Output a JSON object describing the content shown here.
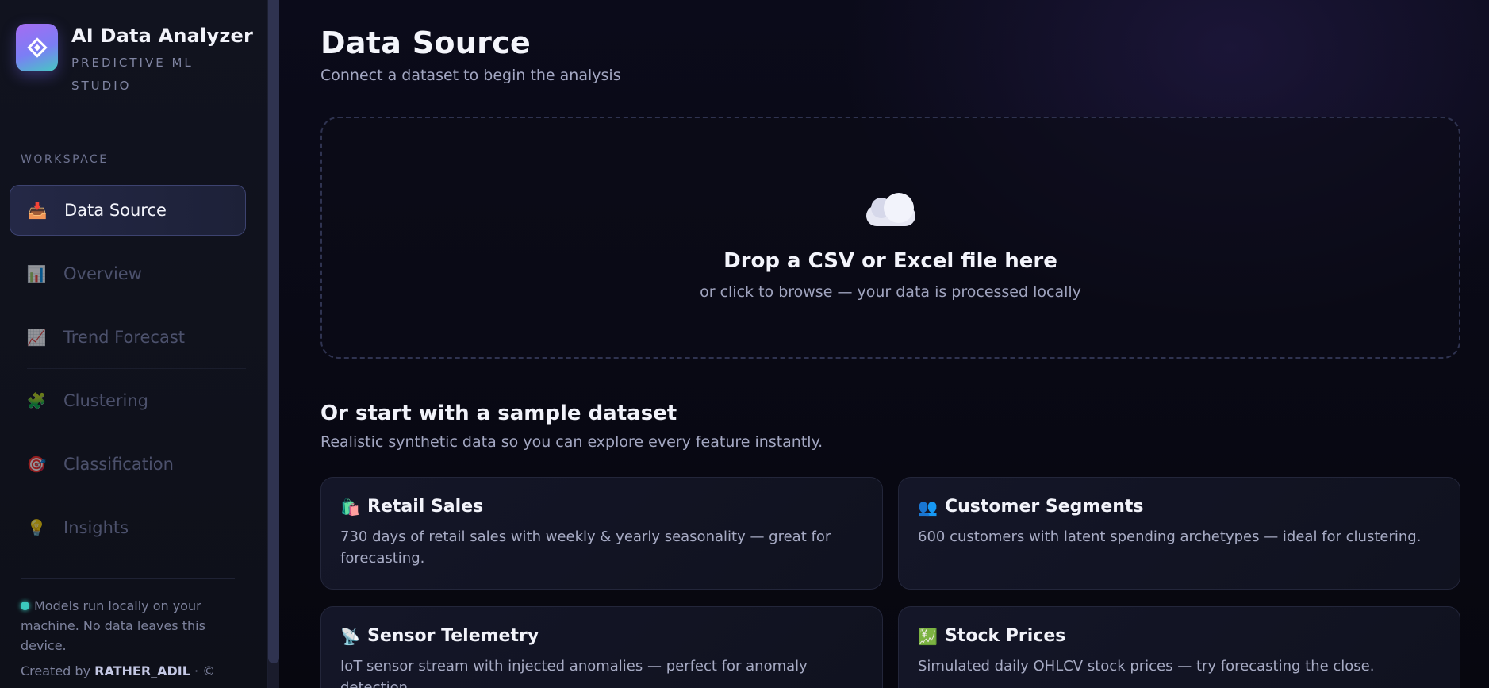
{
  "brand": {
    "title": "AI Data Analyzer",
    "subtitle": "PREDICTIVE ML STUDIO"
  },
  "sidebar": {
    "section_label": "WORKSPACE",
    "items": [
      {
        "label": "Data Source",
        "icon": "inbox-tray-icon",
        "glyph": "📥",
        "active": true
      },
      {
        "label": "Overview",
        "icon": "bar-chart-icon",
        "glyph": "📊",
        "active": false
      },
      {
        "label": "Trend Forecast",
        "icon": "chart-increasing-icon",
        "glyph": "📈",
        "active": false
      },
      {
        "label": "Clustering",
        "icon": "puzzle-piece-icon",
        "glyph": "🧩",
        "active": false
      },
      {
        "label": "Classification",
        "icon": "target-icon",
        "glyph": "🎯",
        "active": false
      },
      {
        "label": "Insights",
        "icon": "light-bulb-icon",
        "glyph": "💡",
        "active": false
      }
    ],
    "local_note": "Models run locally on your machine. No data leaves this device.",
    "credit_prefix": "Created by",
    "credit_name": "RATHER_ADIL",
    "credit_suffix": "· ©"
  },
  "main": {
    "title": "Data Source",
    "subtitle": "Connect a dataset to begin the analysis",
    "dropzone": {
      "icon": "cloud-icon",
      "title": "Drop a CSV or Excel file here",
      "subtitle": "or click to browse — your data is processed locally"
    },
    "samples": {
      "title": "Or start with a sample dataset",
      "subtitle": "Realistic synthetic data so you can explore every feature instantly.",
      "cards": [
        {
          "title": "Retail Sales",
          "icon": "shopping-bags-icon",
          "glyph": "🛍️",
          "description": "730 days of retail sales with weekly & yearly seasonality — great for forecasting."
        },
        {
          "title": "Customer Segments",
          "icon": "people-icon",
          "glyph": "👥",
          "description": "600 customers with latent spending archetypes — ideal for clustering."
        },
        {
          "title": "Sensor Telemetry",
          "icon": "satellite-antenna-icon",
          "glyph": "📡",
          "description": "IoT sensor stream with injected anomalies — perfect for anomaly detection."
        },
        {
          "title": "Stock Prices",
          "icon": "chart-increasing-icon",
          "glyph": "💹",
          "description": "Simulated daily OHLCV stock prices — try forecasting the close."
        }
      ]
    }
  },
  "colors": {
    "accent": "#7b7ef5",
    "teal": "#3bc9be",
    "background": "#0a0b16"
  }
}
